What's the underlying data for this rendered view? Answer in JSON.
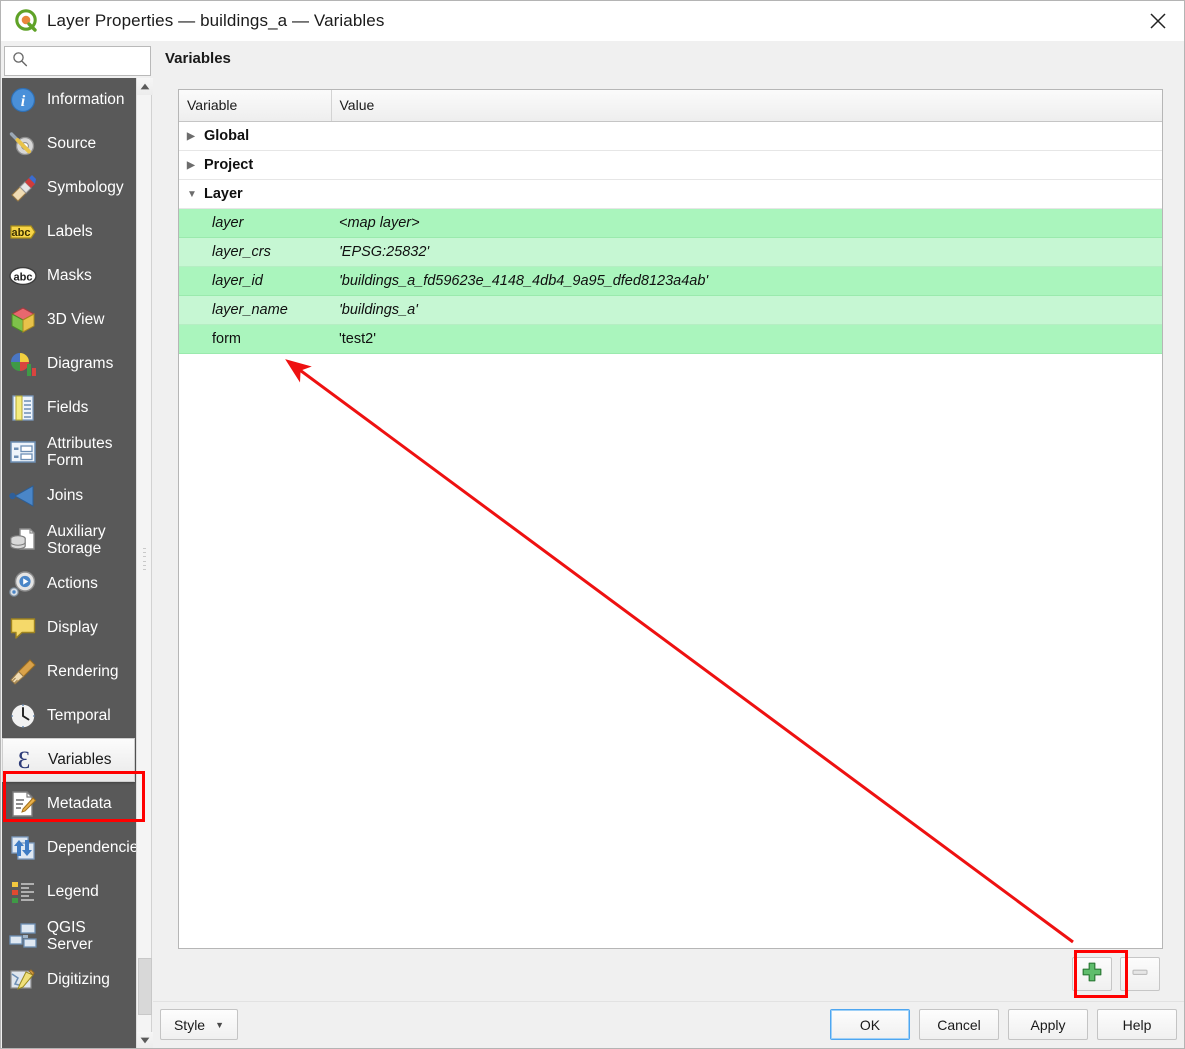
{
  "window": {
    "title": "Layer Properties — buildings_a — Variables",
    "logo_icon": "qgis-logo-icon",
    "close_icon": "close-icon"
  },
  "search": {
    "value": "",
    "placeholder": "",
    "icon": "search-icon"
  },
  "sidebar": {
    "items": [
      {
        "label": "Information",
        "icon": "information-icon",
        "selected": false
      },
      {
        "label": "Source",
        "icon": "source-icon",
        "selected": false
      },
      {
        "label": "Symbology",
        "icon": "symbology-icon",
        "selected": false
      },
      {
        "label": "Labels",
        "icon": "labels-icon",
        "selected": false
      },
      {
        "label": "Masks",
        "icon": "masks-icon",
        "selected": false
      },
      {
        "label": "3D View",
        "icon": "3d-view-icon",
        "selected": false
      },
      {
        "label": "Diagrams",
        "icon": "diagrams-icon",
        "selected": false
      },
      {
        "label": "Fields",
        "icon": "fields-icon",
        "selected": false
      },
      {
        "label": "Attributes\nForm",
        "icon": "attributes-form-icon",
        "selected": false
      },
      {
        "label": "Joins",
        "icon": "joins-icon",
        "selected": false
      },
      {
        "label": "Auxiliary\nStorage",
        "icon": "auxiliary-storage-icon",
        "selected": false
      },
      {
        "label": "Actions",
        "icon": "actions-icon",
        "selected": false
      },
      {
        "label": "Display",
        "icon": "display-icon",
        "selected": false
      },
      {
        "label": "Rendering",
        "icon": "rendering-icon",
        "selected": false
      },
      {
        "label": "Temporal",
        "icon": "temporal-icon",
        "selected": false
      },
      {
        "label": "Variables",
        "icon": "variables-icon",
        "selected": true
      },
      {
        "label": "Metadata",
        "icon": "metadata-icon",
        "selected": false
      },
      {
        "label": "Dependencies",
        "icon": "dependencies-icon",
        "selected": false
      },
      {
        "label": "Legend",
        "icon": "legend-icon",
        "selected": false
      },
      {
        "label": "QGIS\nServer",
        "icon": "qgis-server-icon",
        "selected": false
      },
      {
        "label": "Digitizing",
        "icon": "digitizing-icon",
        "selected": false
      }
    ],
    "scrollbar": {
      "up_icon": "scroll-up-arrow-icon",
      "down_icon": "scroll-down-arrow-icon"
    }
  },
  "main": {
    "panel_title": "Variables",
    "table": {
      "columns": [
        "Variable",
        "Value"
      ],
      "rows": [
        {
          "kind": "group",
          "expanded": false,
          "variable": "Global",
          "value": ""
        },
        {
          "kind": "group",
          "expanded": false,
          "variable": "Project",
          "value": ""
        },
        {
          "kind": "group",
          "expanded": true,
          "variable": "Layer",
          "value": ""
        },
        {
          "kind": "var",
          "shade": "dark",
          "italic": true,
          "variable": "layer",
          "value": "<map layer>"
        },
        {
          "kind": "var",
          "shade": "light",
          "italic": true,
          "variable": "layer_crs",
          "value": "'EPSG:25832'"
        },
        {
          "kind": "var",
          "shade": "dark",
          "italic": true,
          "variable": "layer_id",
          "value": "'buildings_a_fd59623e_4148_4db4_9a95_dfed8123a4ab'"
        },
        {
          "kind": "var",
          "shade": "light",
          "italic": true,
          "variable": "layer_name",
          "value": "'buildings_a'"
        },
        {
          "kind": "var",
          "shade": "dark",
          "italic": false,
          "variable": "form",
          "value": "'test2'"
        }
      ]
    },
    "add_button": {
      "label": "",
      "icon": "add-plus-icon"
    },
    "remove_button": {
      "label": "",
      "icon": "remove-minus-icon"
    }
  },
  "bottom": {
    "style_label": "Style",
    "style_caret_icon": "chevron-down-icon",
    "buttons": [
      {
        "label": "OK",
        "default": true
      },
      {
        "label": "Cancel",
        "default": false
      },
      {
        "label": "Apply",
        "default": false
      },
      {
        "label": "Help",
        "default": false
      }
    ]
  },
  "annotations": {
    "arrow_color": "#ee1111",
    "highlight_color": "#ff0000"
  }
}
